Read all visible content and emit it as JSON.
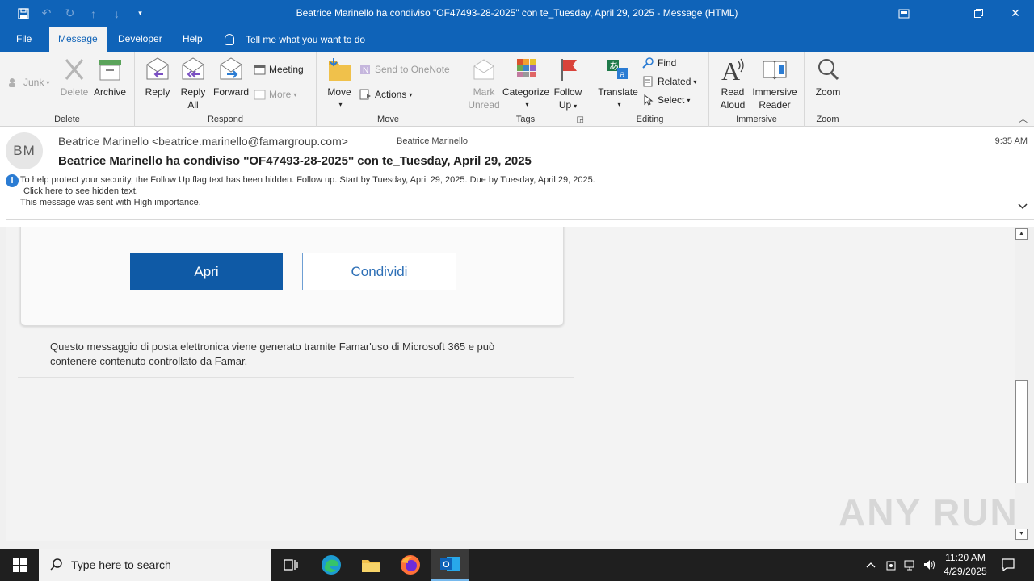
{
  "window": {
    "title": "Beatrice Marinello ha condiviso \"OF47493-28-2025\" con te_Tuesday, April 29, 2025  -  Message (HTML)"
  },
  "tabs": [
    "File",
    "Message",
    "Developer",
    "Help"
  ],
  "tell_me": "Tell me what you want to do",
  "ribbon": {
    "delete_group": {
      "label": "Delete",
      "junk": "Junk",
      "delete": "Delete",
      "archive": "Archive"
    },
    "respond_group": {
      "label": "Respond",
      "reply": "Reply",
      "reply_all_1": "Reply",
      "reply_all_2": "All",
      "forward": "Forward",
      "meeting": "Meeting",
      "more": "More"
    },
    "move_group": {
      "label": "Move",
      "move": "Move",
      "onenote": "Send to OneNote",
      "actions": "Actions"
    },
    "tags_group": {
      "label": "Tags",
      "mark_1": "Mark",
      "mark_2": "Unread",
      "categorize": "Categorize",
      "follow_1": "Follow",
      "follow_2": "Up"
    },
    "editing_group": {
      "label": "Editing",
      "translate": "Translate",
      "find": "Find",
      "related": "Related",
      "select": "Select"
    },
    "immersive_group": {
      "label": "Immersive",
      "read_1": "Read",
      "read_2": "Aloud",
      "imm_1": "Immersive",
      "imm_2": "Reader"
    },
    "zoom_group": {
      "label": "Zoom",
      "zoom": "Zoom"
    }
  },
  "header": {
    "avatar_initials": "BM",
    "from": "Beatrice Marinello <beatrice.marinello@famargroup.com>",
    "to": "Beatrice Marinello",
    "time": "9:35 AM",
    "subject": "Beatrice Marinello ha condiviso ''OF47493-28-2025'' con te_Tuesday, April 29, 2025",
    "info_line1": "To help protect your security, the Follow Up flag text has been hidden. Follow up.  Start by Tuesday, April 29, 2025.  Due by Tuesday, April 29, 2025.",
    "info_line2": "Click here to see hidden text.",
    "info_line3": "This message was sent with High importance."
  },
  "message": {
    "open_button": "Apri",
    "share_button": "Condividi",
    "footer": "Questo messaggio di posta elettronica viene generato tramite Famar'uso di Microsoft 365 e può contenere contenuto controllato da Famar."
  },
  "watermark": "ANY RUN",
  "taskbar": {
    "search_placeholder": "Type here to search",
    "time": "11:20 AM",
    "date": "4/29/2025"
  },
  "colors": {
    "brand": "#0f63b8",
    "primary_button": "#0f5aa6",
    "taskbar": "#1f1f1f"
  }
}
